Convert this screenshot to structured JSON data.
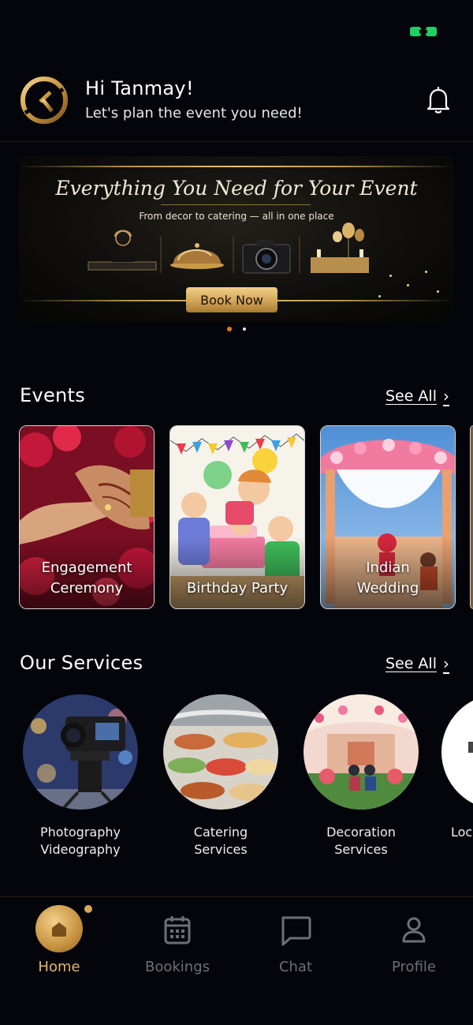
{
  "header": {
    "greeting": "Hi Tanmay!",
    "tagline": "Let's plan the event you need!"
  },
  "banner": {
    "title": "Everything You Need for Your Event",
    "subtitle": "From decor to catering — all in one place",
    "cta_label": "Book Now",
    "slide_count": 2,
    "active_slide": 1
  },
  "events": {
    "title": "Events",
    "see_all": "See All",
    "items": [
      {
        "label_line1": "Engagement",
        "label_line2": "Ceremony"
      },
      {
        "label_line1": "Birthday Party",
        "label_line2": ""
      },
      {
        "label_line1": "Indian",
        "label_line2": "Wedding"
      }
    ]
  },
  "services": {
    "title": "Our Services",
    "see_all": "See All",
    "items": [
      {
        "label_line1": "Photography",
        "label_line2": "Videography"
      },
      {
        "label_line1": "Catering",
        "label_line2": "Services"
      },
      {
        "label_line1": "Decoration",
        "label_line2": "Services"
      },
      {
        "label_line1": "Loc",
        "label_line2": ""
      }
    ]
  },
  "nav": {
    "items": [
      {
        "label": "Home",
        "icon": "home-icon",
        "active": true
      },
      {
        "label": "Bookings",
        "icon": "calendar-icon",
        "active": false
      },
      {
        "label": "Chat",
        "icon": "chat-icon",
        "active": false
      },
      {
        "label": "Profile",
        "icon": "user-icon",
        "active": false
      }
    ]
  },
  "colors": {
    "background": "#04050b",
    "accent_gold": "#d9a657",
    "nav_inactive": "#6d6f78",
    "battery_green": "#1fd065"
  }
}
